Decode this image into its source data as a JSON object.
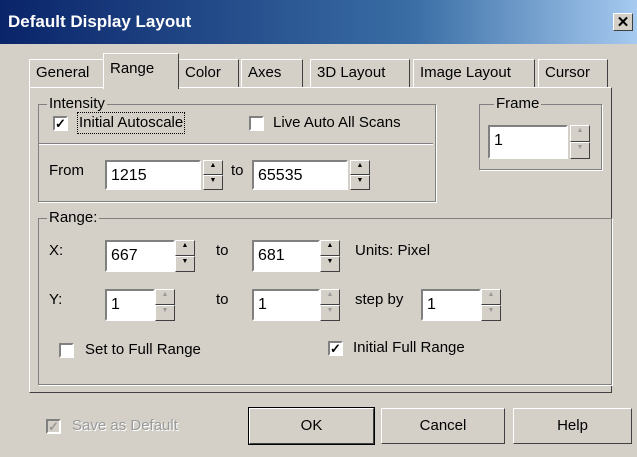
{
  "window": {
    "title": "Default Display Layout",
    "close_glyph": "✕"
  },
  "tabs": [
    "General",
    "Range",
    "Color",
    "Axes",
    "3D Layout",
    "Image Layout",
    "Cursor"
  ],
  "active_tab": "Range",
  "intensity": {
    "legend": "Intensity",
    "initial_autoscale_label": "Initial Autoscale",
    "initial_autoscale_checked": true,
    "live_auto_label": "Live Auto All Scans",
    "live_auto_checked": false,
    "from_label": "From",
    "from_value": "1215",
    "to_label": "to",
    "to_value": "65535"
  },
  "frame": {
    "legend": "Frame",
    "value": "1"
  },
  "range": {
    "legend": "Range:",
    "x_label": "X:",
    "x_from": "667",
    "x_to_label": "to",
    "x_to": "681",
    "units_label": "Units: Pixel",
    "y_label": "Y:",
    "y_from": "1",
    "y_to_label": "to",
    "y_to": "1",
    "step_label": "step by",
    "step_value": "1",
    "set_full_label": "Set to Full Range",
    "set_full_checked": false,
    "initial_full_label": "Initial Full Range",
    "initial_full_checked": true
  },
  "footer": {
    "save_default_label": "Save as Default",
    "save_default_checked": true,
    "ok_label": "OK",
    "cancel_label": "Cancel",
    "help_label": "Help"
  },
  "glyphs": {
    "check": "✓",
    "spin_up": "▲",
    "spin_down": "▼"
  }
}
